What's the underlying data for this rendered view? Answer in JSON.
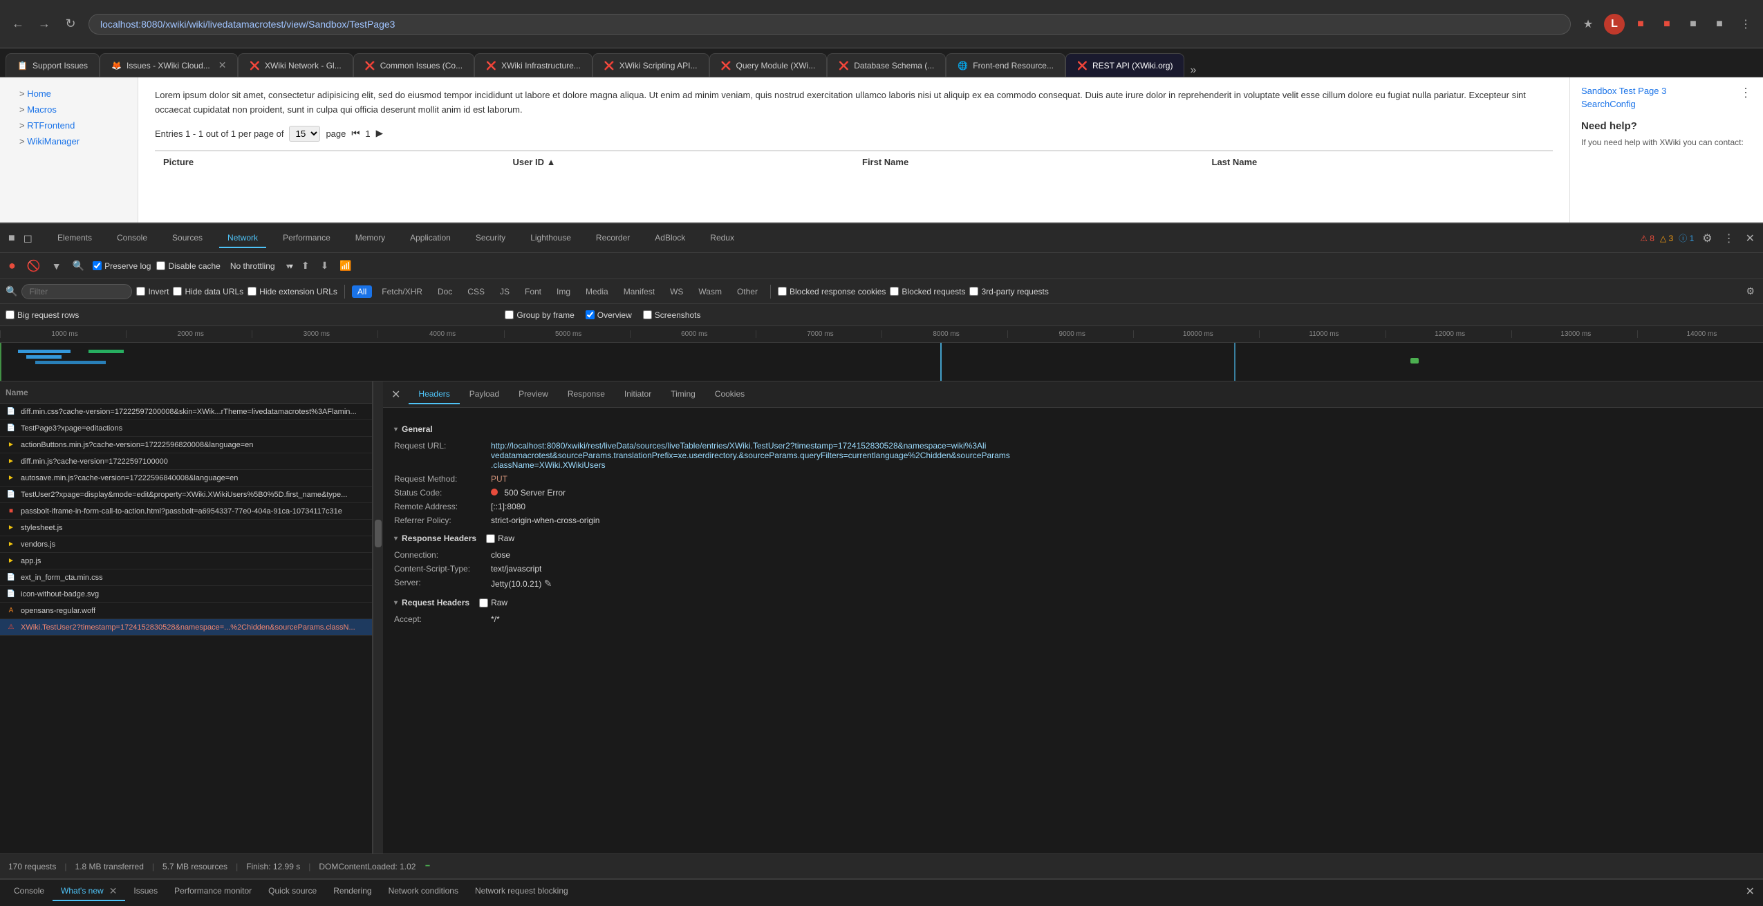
{
  "browser": {
    "url": "localhost:8080/xwiki/wiki/livedatamacrotest/view/Sandbox/TestPage3",
    "back": "←",
    "forward": "→",
    "reload": "↻",
    "tabs": [
      {
        "label": "Support Issues",
        "favicon": "📋",
        "active": false
      },
      {
        "label": "Issues - XWiki Cloud...",
        "favicon": "🦊",
        "active": false
      },
      {
        "label": "XWiki Network - Gi...",
        "favicon": "❌",
        "active": false
      },
      {
        "label": "Common Issues (Co...",
        "favicon": "❌",
        "active": false
      },
      {
        "label": "XWiki Infrastructure...",
        "favicon": "❌",
        "active": false
      },
      {
        "label": "XWiki Scripting API...",
        "favicon": "❌",
        "active": false
      },
      {
        "label": "Query Module (XWi...",
        "favicon": "❌",
        "active": false
      },
      {
        "label": "Database Schema (...",
        "favicon": "❌",
        "active": false
      },
      {
        "label": "Front-end Resource...",
        "favicon": "🌐",
        "active": false
      },
      {
        "label": "REST API (XWiki.org)",
        "favicon": "❌",
        "active": true
      }
    ],
    "more": "»"
  },
  "page": {
    "sidebar": {
      "items": [
        "Home",
        "Macros",
        "RTFrontend",
        "WikiManager"
      ]
    },
    "main_text": "Lorem ipsum dolor sit amet, consectetur adipisicing elit, sed do eiusmod tempor incididunt ut labore et dolore magna aliqua. Ut enim ad minim veniam, quis nostrud exercitation ullamco laboris nisi ut aliquip ex ea commodo consequat. Duis aute irure dolor in reprehenderit in voluptate velit esse cillum dolore eu fugiat nulla pariatur. Excepteur sint occaecat cupidatat non proident, sunt in culpa qui officia deserunt mollit anim id est laborum.",
    "pagination": "Entries 1 - 1 out of 1 per page of",
    "per_page": "15",
    "page_label": "page",
    "page_num": "1",
    "table_headers": [
      "Picture",
      "User ID ↑",
      "First Name",
      "Last Name"
    ],
    "right_links": [
      "Sandbox Test Page 3",
      "SearchConfig"
    ],
    "help_title": "Need help?",
    "help_text": "If you need help with XWiki you can contact:"
  },
  "devtools": {
    "tabs": [
      "Elements",
      "Console",
      "Sources",
      "Network",
      "Performance",
      "Memory",
      "Application",
      "Security",
      "Lighthouse",
      "Recorder",
      "AdBlock",
      "Redux"
    ],
    "active_tab": "Network",
    "badges": {
      "errors": "8",
      "warnings": "3",
      "info": "1"
    },
    "settings_icon": "⚙",
    "more_icon": "⋮",
    "close_icon": "✕"
  },
  "network": {
    "toolbar": {
      "record": "⏺",
      "clear": "🚫",
      "filter": "🔽",
      "search": "🔍",
      "preserve_log": "Preserve log",
      "disable_cache": "Disable cache",
      "throttling": "No throttling",
      "upload": "⬆",
      "download": "⬇"
    },
    "filter_bar": {
      "placeholder": "Filter",
      "invert": "Invert",
      "hide_data_urls": "Hide data URLs",
      "hide_ext_urls": "Hide extension URLs",
      "types": [
        "All",
        "Fetch/XHR",
        "Doc",
        "CSS",
        "JS",
        "Font",
        "Img",
        "Media",
        "Manifest",
        "WS",
        "Wasm",
        "Other"
      ],
      "active_type": "All",
      "blocked_response_cookies": "Blocked response cookies",
      "blocked_requests": "Blocked requests",
      "third_party": "3rd-party requests"
    },
    "options": {
      "big_request_rows": "Big request rows",
      "group_by_frame": "Group by frame",
      "overview": "Overview",
      "screenshots": "Screenshots"
    },
    "timeline_ticks": [
      "1000 ms",
      "2000 ms",
      "3000 ms",
      "4000 ms",
      "5000 ms",
      "6000 ms",
      "7000 ms",
      "8000 ms",
      "9000 ms",
      "10000 ms",
      "11000 ms",
      "12000 ms",
      "13000 ms",
      "14000 ms"
    ],
    "requests": [
      {
        "name": "diff.min.css?cache-version=17222597200008&skin=XWik...rTheme=livedatamacrotest%3AFlamin...",
        "type": "css",
        "error": false
      },
      {
        "name": "TestPage3?xpage=editactions",
        "type": "doc",
        "error": false
      },
      {
        "name": "actionButtons.min.js?cache-version=17222596820008&language=en",
        "type": "js",
        "error": false
      },
      {
        "name": "diff.min.js?cache-version=17222597100000",
        "type": "js",
        "error": false
      },
      {
        "name": "autosave.min.js?cache-version=17222596840008&language=en",
        "type": "js",
        "error": false
      },
      {
        "name": "TestUser2?xpage=display&mode=edit&property=XWiki.XWikiUsers%5B0%5D.first_name&type...",
        "type": "doc",
        "error": false
      },
      {
        "name": "passbolt-iframe-in-form-call-to-action.html?passbolt=a6954337-77e0-404a-91ca-10734117c31e",
        "type": "other",
        "error": false
      },
      {
        "name": "stylesheet.js",
        "type": "js",
        "error": false
      },
      {
        "name": "vendors.js",
        "type": "js",
        "error": false
      },
      {
        "name": "app.js",
        "type": "js",
        "error": false
      },
      {
        "name": "ext_in_form_cta.min.css",
        "type": "css",
        "error": false
      },
      {
        "name": "icon-without-badge.svg",
        "type": "img",
        "error": false
      },
      {
        "name": "opensans-regular.woff",
        "type": "font",
        "error": false
      },
      {
        "name": "XWiki.TestUser2?timestamp=1724152830528&namespace=...%2Chidden&sourceParams.classN...",
        "type": "xhr",
        "error": true,
        "selected": true
      }
    ],
    "request_count": "170 requests",
    "transferred": "1.8 MB transferred",
    "resources": "5.7 MB resources",
    "finish": "Finish: 12.99 s",
    "dom_loaded": "DOMContentLoaded: 1.02"
  },
  "details": {
    "close": "✕",
    "tabs": [
      "Headers",
      "Payload",
      "Preview",
      "Response",
      "Initiator",
      "Timing",
      "Cookies"
    ],
    "active_tab": "Headers",
    "general_section": "General",
    "request_url_label": "Request URL:",
    "request_url_value": "http://localhost:8080/xwiki/rest/liveData/sources/liveTable/entries/XWiki.TestUser2?timestamp=1724152830528&namespace=wiki%3Ali\nvedatamacrotest&sourceParams.translationPrefix=xe.userdirectory.&sourceParams.queryFilters=currentlanguage%2Chidden&sourceParar\nams.className=XWiki.XWikiUsers",
    "request_method_label": "Request Method:",
    "request_method_value": "PUT",
    "status_code_label": "Status Code:",
    "status_code_value": "500 Server Error",
    "remote_address_label": "Remote Address:",
    "remote_address_value": "[::1]:8080",
    "referrer_policy_label": "Referrer Policy:",
    "referrer_policy_value": "strict-origin-when-cross-origin",
    "response_headers_section": "Response Headers",
    "raw_label": "Raw",
    "connection_label": "Connection:",
    "connection_value": "close",
    "content_script_type_label": "Content-Script-Type:",
    "content_script_type_value": "text/javascript",
    "server_label": "Server:",
    "server_value": "Jetty(10.0.21)",
    "request_headers_section": "Request Headers",
    "accept_label": "Accept:",
    "accept_value": "*/*"
  },
  "bottom_bar": {
    "tabs": [
      "Console",
      "What's new",
      "Issues",
      "Performance monitor",
      "Quick source",
      "Rendering",
      "Network conditions",
      "Network request blocking"
    ],
    "active_tab": "What's new",
    "console_icon": ">_",
    "whats_new_label": "What's new"
  }
}
